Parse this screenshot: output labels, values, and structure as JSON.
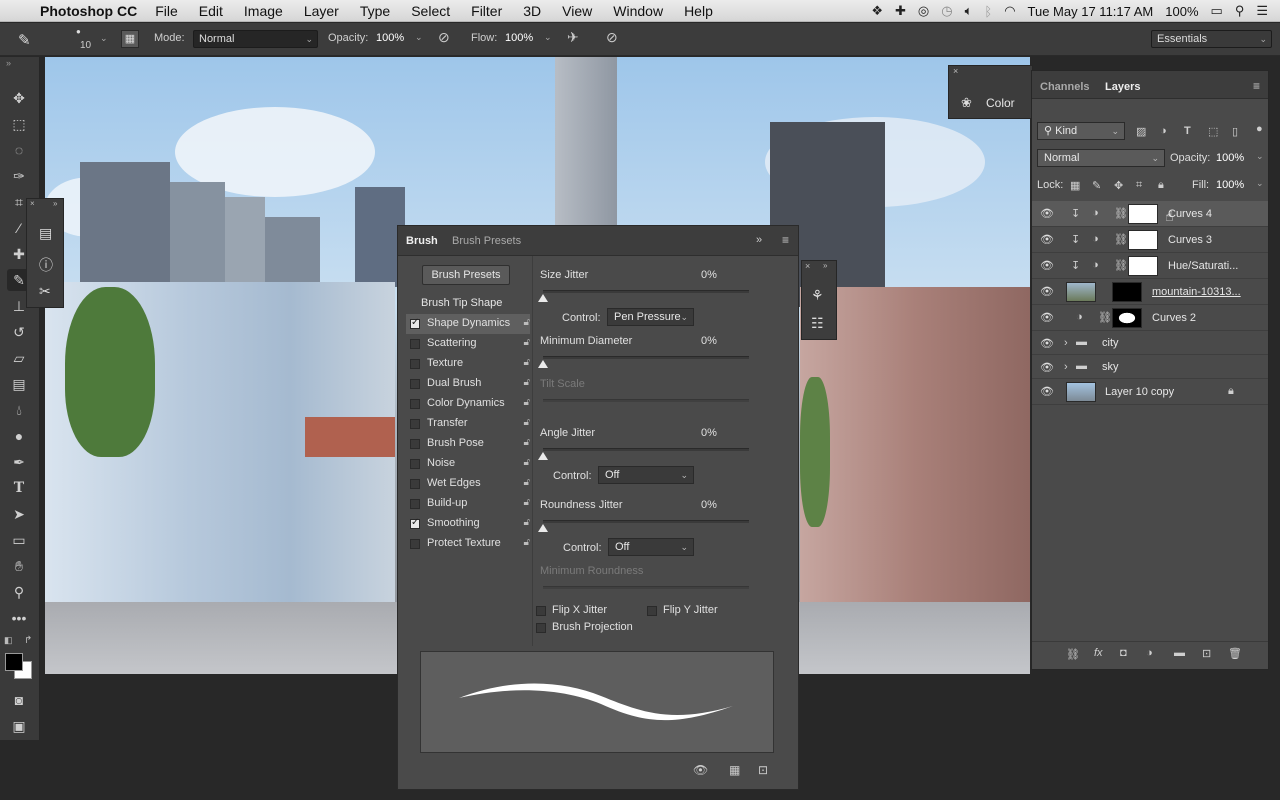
{
  "menubar": {
    "app_name": "Photoshop CC",
    "menus": [
      "File",
      "Edit",
      "Image",
      "Layer",
      "Type",
      "Select",
      "Filter",
      "3D",
      "View",
      "Window",
      "Help"
    ],
    "clock": "Tue May 17  11:17 AM",
    "battery": "100%"
  },
  "options": {
    "brush_size": "10",
    "mode_label": "Mode:",
    "mode_value": "Normal",
    "opacity_label": "Opacity:",
    "opacity_value": "100%",
    "flow_label": "Flow:",
    "flow_value": "100%",
    "workspace": "Essentials"
  },
  "color_panel": {
    "title": "Color"
  },
  "brush_panel": {
    "tab_active": "Brush",
    "tab_inactive": "Brush Presets",
    "presets_button": "Brush Presets",
    "tip_shape": "Brush Tip Shape",
    "options": [
      {
        "label": "Shape Dynamics",
        "checked": true
      },
      {
        "label": "Scattering",
        "checked": false
      },
      {
        "label": "Texture",
        "checked": false
      },
      {
        "label": "Dual Brush",
        "checked": false
      },
      {
        "label": "Color Dynamics",
        "checked": false
      },
      {
        "label": "Transfer",
        "checked": false
      },
      {
        "label": "Brush Pose",
        "checked": false
      },
      {
        "label": "Noise",
        "checked": false
      },
      {
        "label": "Wet Edges",
        "checked": false
      },
      {
        "label": "Build-up",
        "checked": false
      },
      {
        "label": "Smoothing",
        "checked": true
      },
      {
        "label": "Protect Texture",
        "checked": false
      }
    ],
    "size_jitter_label": "Size Jitter",
    "size_jitter_value": "0%",
    "control_label": "Control:",
    "control_1": "Pen Pressure",
    "min_diameter_label": "Minimum Diameter",
    "min_diameter_value": "0%",
    "tilt_scale_label": "Tilt Scale",
    "angle_jitter_label": "Angle Jitter",
    "angle_jitter_value": "0%",
    "control_2": "Off",
    "roundness_jitter_label": "Roundness Jitter",
    "roundness_jitter_value": "0%",
    "control_3": "Off",
    "min_roundness_label": "Minimum Roundness",
    "flip_x": "Flip X Jitter",
    "flip_y": "Flip Y Jitter",
    "brush_projection": "Brush Projection"
  },
  "layers_panel": {
    "tab_channels": "Channels",
    "tab_layers": "Layers",
    "filter_kind": "Kind",
    "blend_mode": "Normal",
    "opacity_label": "Opacity:",
    "opacity_value": "100%",
    "lock_label": "Lock:",
    "fill_label": "Fill:",
    "fill_value": "100%",
    "layers": [
      {
        "name": "Curves 4",
        "selected": true
      },
      {
        "name": "Curves 3",
        "selected": false
      },
      {
        "name": "Hue/Saturati...",
        "selected": false
      },
      {
        "name": "mountain-10313...",
        "selected": false
      },
      {
        "name": "Curves 2",
        "selected": false
      },
      {
        "name": "city",
        "selected": false
      },
      {
        "name": "sky",
        "selected": false
      },
      {
        "name": "Layer 10 copy",
        "selected": false
      }
    ]
  },
  "colors": {
    "panel_bg": "#4a4a4a",
    "panel_dark": "#3c3c3c",
    "selected_row": "#5a5a5a"
  }
}
